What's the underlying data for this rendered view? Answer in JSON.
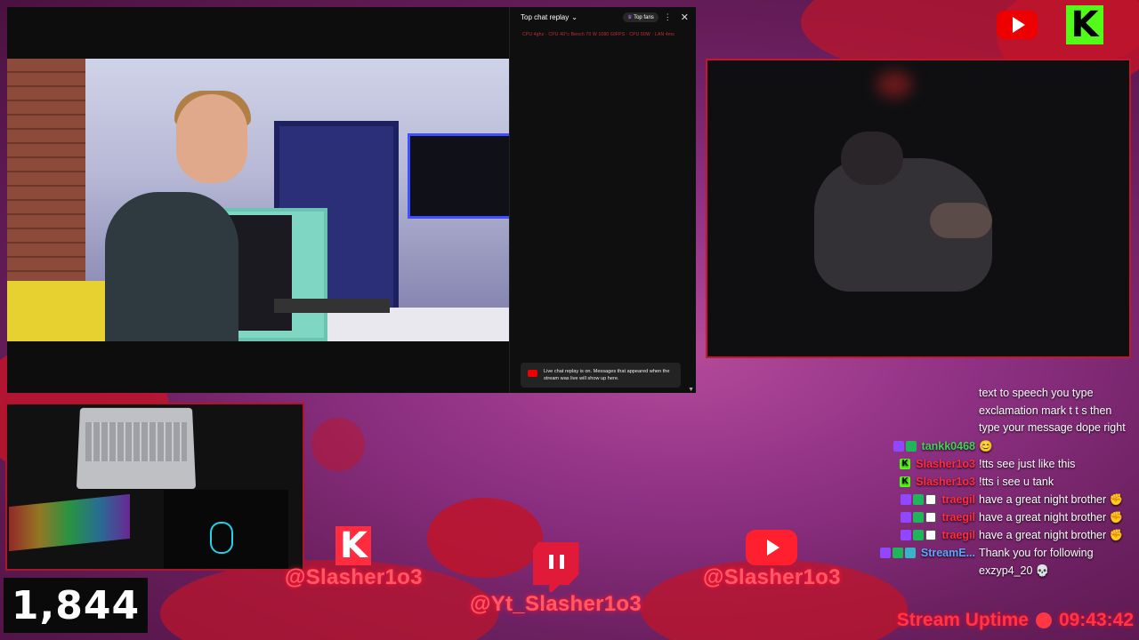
{
  "chat_panel": {
    "title": "Top chat replay",
    "top_fans": "Top fans",
    "notice": "Live chat replay is on. Messages that appeared when the stream was live will show up here.",
    "red_line": "CPU 4ghz  ·  CPU 40°c  Bench 70 W  1080 60FPS  ·  CPU 50W  ·  LAN 4ms"
  },
  "follower_count": "1,844",
  "socials": {
    "kick_handle": "@Slasher1o3",
    "twitch_handle": "@Yt_Slasher1o3",
    "youtube_handle": "@Slasher1o3"
  },
  "overlay_chat": {
    "intro_lines": [
      "text to speech you type",
      "exclamation mark t t s then",
      "type your message dope right"
    ],
    "messages": [
      {
        "name": "tankk0468",
        "name_color": "#3fd35a",
        "badges": [
          "purple",
          "green"
        ],
        "text": "😊"
      },
      {
        "name": "Slasher1o3",
        "name_color": "#ff2d3d",
        "badges": [
          "kick"
        ],
        "text": "!tts see just like this"
      },
      {
        "name": "Slasher1o3",
        "name_color": "#ff2d3d",
        "badges": [
          "kick"
        ],
        "text": "!tts i see u tank"
      },
      {
        "name": "traegil",
        "name_color": "#ff2d3d",
        "badges": [
          "purple",
          "green",
          "mute"
        ],
        "text": "have a great night brother ✊"
      },
      {
        "name": "traegil",
        "name_color": "#ff2d3d",
        "badges": [
          "purple",
          "green",
          "mute"
        ],
        "text": "have a great night brother ✊"
      },
      {
        "name": "traegil",
        "name_color": "#ff2d3d",
        "badges": [
          "purple",
          "green",
          "mute"
        ],
        "text": "have a great night brother ✊"
      },
      {
        "name": "StreamE...",
        "name_color": "#5aa7ff",
        "badges": [
          "purple",
          "green",
          "bot"
        ],
        "text": "Thank you for following"
      }
    ],
    "last_line": "exzyp4_20 💀"
  },
  "uptime": {
    "label": "Stream Uptime",
    "time": "09:43:42"
  }
}
